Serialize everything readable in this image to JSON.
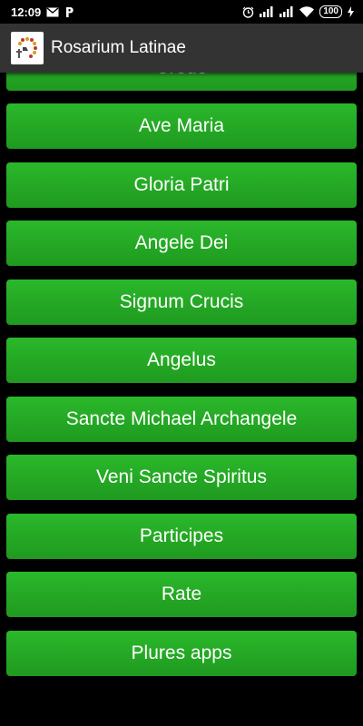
{
  "status_bar": {
    "time": "12:09",
    "battery": "100"
  },
  "app_bar": {
    "title": "Rosarium Latinae"
  },
  "buttons": [
    {
      "label": "Credo"
    },
    {
      "label": "Ave Maria"
    },
    {
      "label": "Gloria Patri"
    },
    {
      "label": "Angele Dei"
    },
    {
      "label": "Signum Crucis"
    },
    {
      "label": "Angelus"
    },
    {
      "label": "Sancte Michael Archangele"
    },
    {
      "label": "Veni Sancte Spiritus"
    },
    {
      "label": "Participes"
    },
    {
      "label": "Rate"
    },
    {
      "label": "Plures apps"
    }
  ],
  "colors": {
    "button_green": "#22a822",
    "app_bar": "#333333",
    "background": "#000000"
  }
}
